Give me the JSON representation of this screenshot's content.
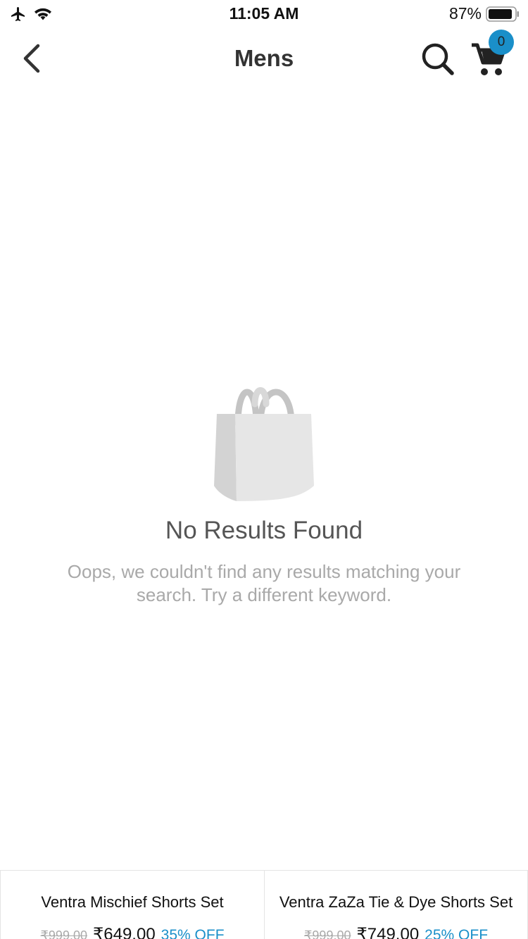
{
  "status_bar": {
    "time": "11:05 AM",
    "battery": "87%"
  },
  "nav": {
    "title": "Mens",
    "cart_count": "0"
  },
  "empty_state": {
    "heading": "No Results Found",
    "message": "Oops, we couldn't find any results matching your search. Try a different keyword."
  },
  "products": [
    {
      "name": "Ventra Mischief Shorts Set",
      "old_price": "₹999.00",
      "price": "₹649.00",
      "discount": "35% OFF"
    },
    {
      "name": "Ventra ZaZa Tie & Dye Shorts Set",
      "old_price": "₹999.00",
      "price": "₹749.00",
      "discount": "25% OFF"
    }
  ],
  "colors": {
    "accent": "#1a8fc9",
    "muted": "#a9a9a9"
  },
  "icons": [
    "airplane-icon",
    "wifi-icon",
    "battery-icon",
    "back-arrow-icon",
    "search-icon",
    "cart-icon",
    "shopping-bag-icon"
  ]
}
